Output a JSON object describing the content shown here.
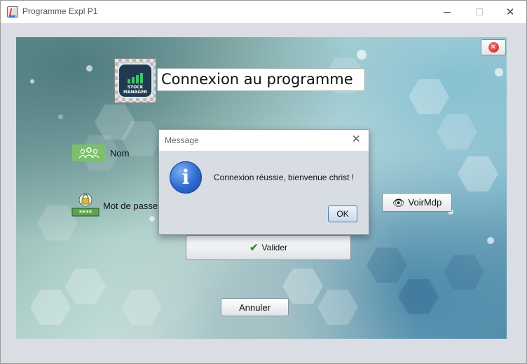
{
  "window": {
    "title": "Programme Expl P1",
    "icon": "java-app-icon",
    "controls": [
      "minimize-icon",
      "maximize-icon",
      "close-icon"
    ]
  },
  "main": {
    "logo": {
      "icon": "stock-manager-logo",
      "text_line1": "STOCK",
      "text_line2": "MANAGER"
    },
    "title_field_value": "Connexion au programme",
    "nom_label": "Nom",
    "mot_de_passe_label": "Mot de passe",
    "voir_mdp_label": "VoirMdp",
    "valider_label": "Valider",
    "annuler_label": "Annuler",
    "close_app_icon": "red-close-icon"
  },
  "dialog": {
    "title": "Message",
    "message": "Connexion réussie, bienvenue christ !",
    "ok_label": "OK",
    "icon": "info-icon"
  },
  "colors": {
    "window_bg": "#dadde3",
    "info_blue": "#2d6bd0",
    "check_green": "#2f9a2f",
    "close_red": "#c81d1d",
    "user_icon_green": "#7cc06e"
  }
}
